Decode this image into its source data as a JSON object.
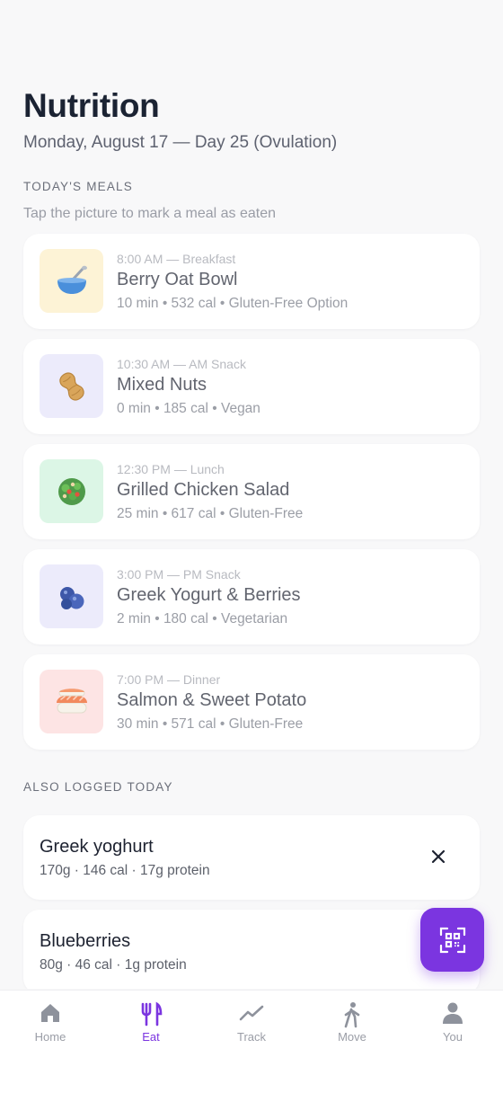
{
  "header": {
    "title": "Nutrition",
    "subtitle": "Monday, August 17 — Day 25 (Ovulation)"
  },
  "meals_section": {
    "label": "TODAY'S MEALS",
    "hint": "Tap the picture to mark a meal as eaten",
    "meals": [
      {
        "time": "8:00 AM — Breakfast",
        "name": "Berry Oat Bowl",
        "meta": "10 min • 532 cal • Gluten-Free Option",
        "icon": "bowl-icon",
        "thumb_color": "#fdf3d6"
      },
      {
        "time": "10:30 AM — AM Snack",
        "name": "Mixed Nuts",
        "meta": "0 min • 185 cal • Vegan",
        "icon": "peanut-icon",
        "thumb_color": "#ecebfb"
      },
      {
        "time": "12:30 PM — Lunch",
        "name": "Grilled Chicken Salad",
        "meta": "25 min • 617 cal • Gluten-Free",
        "icon": "salad-icon",
        "thumb_color": "#dcf6e6"
      },
      {
        "time": "3:00 PM — PM Snack",
        "name": "Greek Yogurt & Berries",
        "meta": "2 min • 180 cal • Vegetarian",
        "icon": "blueberries-icon",
        "thumb_color": "#ecebfb"
      },
      {
        "time": "7:00 PM — Dinner",
        "name": "Salmon & Sweet Potato",
        "meta": "30 min • 571 cal • Gluten-Free",
        "icon": "sushi-icon",
        "thumb_color": "#fde4e4"
      }
    ]
  },
  "logged_section": {
    "label": "ALSO LOGGED TODAY",
    "items": [
      {
        "name": "Greek yoghurt",
        "meta": "170g · 146 cal · 17g protein"
      },
      {
        "name": "Blueberries",
        "meta": "80g · 46 cal · 1g protein"
      }
    ]
  },
  "fab": {
    "icon": "scan-icon"
  },
  "tabbar": {
    "tabs": [
      {
        "label": "Home",
        "icon": "home-icon"
      },
      {
        "label": "Eat",
        "icon": "fork-knife-icon",
        "active": true
      },
      {
        "label": "Track",
        "icon": "trend-icon"
      },
      {
        "label": "Move",
        "icon": "walking-icon"
      },
      {
        "label": "You",
        "icon": "person-icon"
      }
    ]
  },
  "colors": {
    "accent": "#7b35e0",
    "background": "#f8f8f9",
    "card": "#ffffff"
  }
}
